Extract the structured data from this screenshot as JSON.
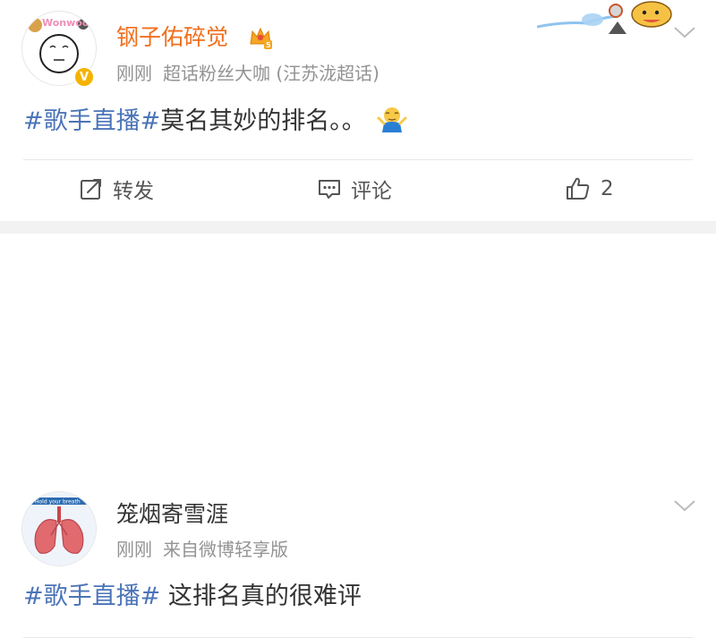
{
  "posts": [
    {
      "author": "钢子佑碎觉",
      "time": "刚刚",
      "source": "超话粉丝大咖 (汪苏泷超话)",
      "topic": "#歌手直播#",
      "text": "莫名其妙的排名。。",
      "verified_badge": "V",
      "level_badge": "5",
      "avatar_badge_text": "Wonwoo",
      "actions": {
        "repost_label": "转发",
        "comment_label": "评论",
        "like_count": "2"
      }
    },
    {
      "author": "笼烟寄雪涯",
      "time": "刚刚",
      "source": "来自微博轻享版",
      "topic": "#歌手直播#",
      "text": " 这排名真的很难评",
      "avatar_caption": "Hold your breath"
    }
  ],
  "colors": {
    "author_highlight": "#f06f1e",
    "topic_link": "#4b74b8",
    "meta_text": "#939393",
    "separator_band": "#f2f2f2"
  },
  "icons": [
    "crown-badge-icon",
    "chevron-down-icon",
    "repost-icon",
    "comment-icon",
    "like-icon",
    "shrug-emoji-icon",
    "verified-v-icon"
  ]
}
